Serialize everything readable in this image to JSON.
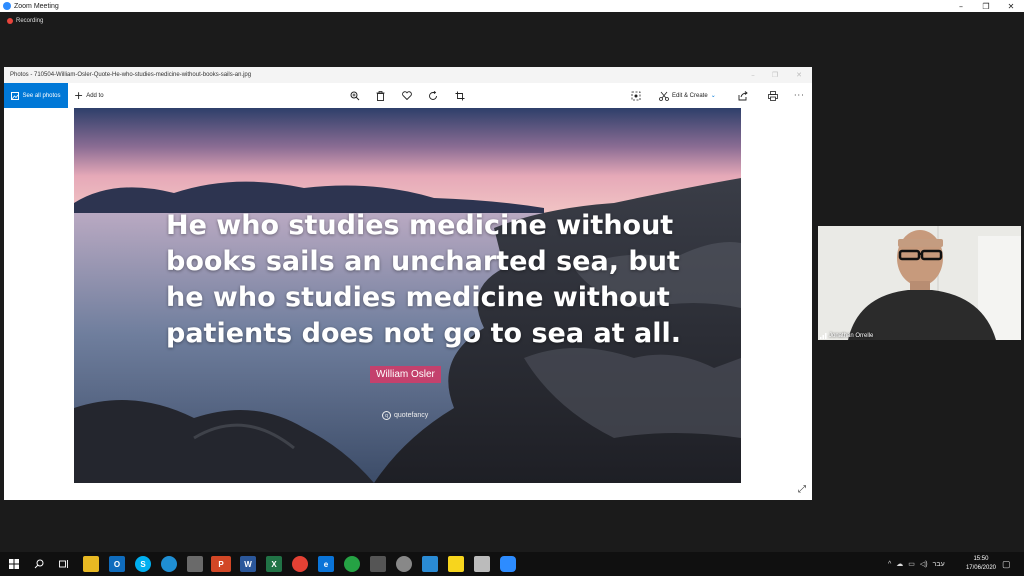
{
  "window": {
    "title": "Zoom Meeting",
    "minimize": "–",
    "restore": "❐",
    "close": "✕"
  },
  "recording": {
    "label": "Recording"
  },
  "photos": {
    "title": "Photos - 710504-William-Osler-Quote-He-who-studies-medicine-without-books-sails-an.jpg",
    "toolbar": {
      "see_all": "See all photos",
      "add_to": "Add to",
      "edit_create": "Edit & Create"
    },
    "image": {
      "quote": "He who studies medicine without books sails an uncharted sea, but he who studies medicine without patients does not go to sea at all.",
      "author": "William Osler",
      "brand": "quotefancy"
    }
  },
  "video": {
    "participant": "Jonathan Orrelle"
  },
  "taskbar": {
    "language": "עבר",
    "time": "15:50",
    "date": "17/06/2020"
  },
  "colors": {
    "accent": "#0078d7",
    "author_badge": "#c4416d",
    "recording": "#e8453c"
  }
}
